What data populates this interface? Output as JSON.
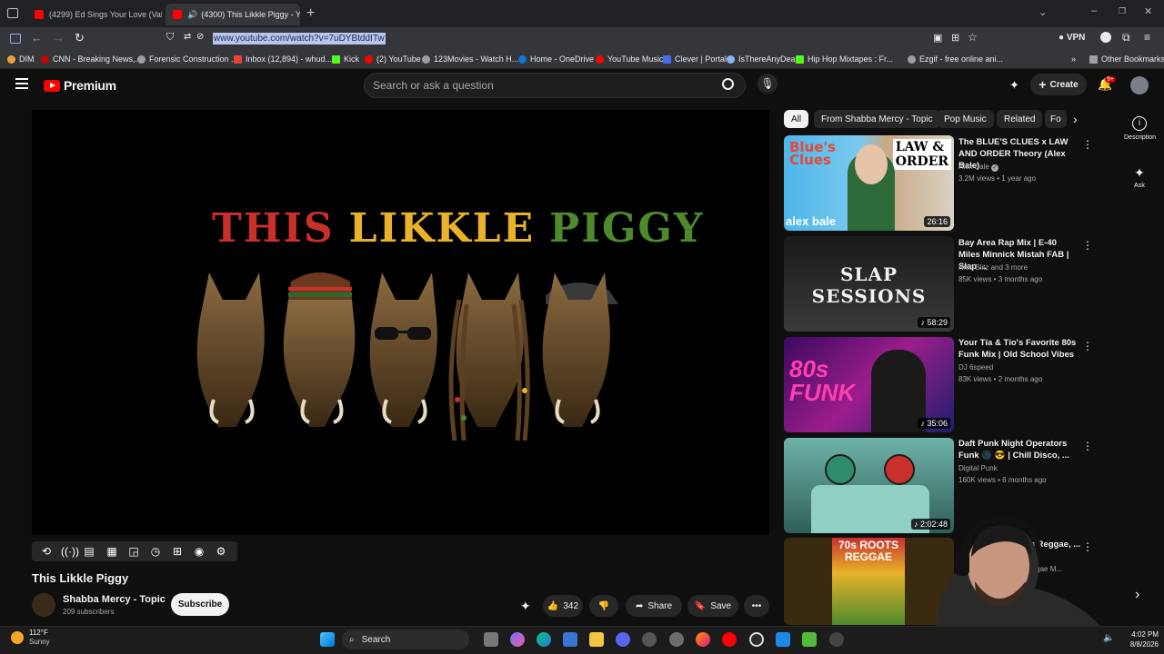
{
  "browser": {
    "tabs": [
      {
        "label": "(4299) Ed Sings Your Love (Vala…"
      },
      {
        "label": "(4300) This Likkle Piggy - Y…"
      }
    ],
    "url": "www.youtube.com/watch?v=7uDYBtddITw",
    "vpn_label": "VPN",
    "bookmarks": [
      "DIM",
      "CNN - Breaking News,...",
      "Forensic Construction ...",
      "Inbox (12,894) - whud...",
      "Kick",
      "(2) YouTube",
      "123Movies - Watch H...",
      "Home - OneDrive",
      "YouTube Music",
      "Clever | Portal",
      "IsThereAnyDeal",
      "Hip Hop Mixtapes : Fr...",
      "Ezgif - free online ani..."
    ],
    "other_bookmarks": "Other Bookmarks"
  },
  "yt": {
    "logo_text": "Premium",
    "search_placeholder": "Search or ask a question",
    "create_label": "Create",
    "notif_badge": "9+",
    "video_art": {
      "words": [
        "THIS",
        "LIKKLE",
        "PIGGY"
      ],
      "word_colors": [
        "#c9302c",
        "#e8b22a",
        "#4e8a2c"
      ]
    },
    "video_title": "This Likkle Piggy",
    "channel_name": "Shabba Mercy - Topic",
    "subscribers": "209 subscribers",
    "subscribe_label": "Subscribe",
    "likes": "342",
    "share_label": "Share",
    "save_label": "Save",
    "chips": [
      "All",
      "From Shabba Mercy - Topic",
      "Pop Music",
      "Related",
      "Fo"
    ],
    "side_rail": {
      "description": "Description",
      "ask": "Ask"
    },
    "recommendations": [
      {
        "title": "The BLUE'S CLUES x LAW AND ORDER Theory (Alex Bale)",
        "channel": "Alex Bale",
        "meta": "3.2M views • 1 year ago",
        "duration": "26:16",
        "thumb_text": "alex bale"
      },
      {
        "title": "Bay Area Rap Mix | E-40 Miles Minnick Mistah FAB | Slap ...",
        "channel": "Nico Blitz and 3 more",
        "meta": "85K views • 3 months ago",
        "duration": "58:29",
        "thumb_text": "SLAP SESSIONS"
      },
      {
        "title": "Your Tía & Tío's Favorite 80s Funk Mix | Old School Vibes",
        "channel": "DJ 6speed",
        "meta": "83K views • 2 months ago",
        "duration": "35:06",
        "thumb_text": "80s FUNK"
      },
      {
        "title": "Daft Punk Night Operators Funk 🌑 😎 | Chill Disco, ...",
        "channel": "Digital Punk",
        "meta": "160K views • 6 months ago",
        "duration": "2:02:48",
        "thumb_text": ""
      },
      {
        "title": "...oots Reggae, ... Box",
        "channel": "...ggae M...",
        "meta": "",
        "duration": "",
        "thumb_text": "70s ROOTS REGGAE"
      }
    ]
  },
  "taskbar": {
    "weather_temp": "112°F",
    "weather_desc": "Sunny",
    "search_label": "Search",
    "time": "4:02 PM",
    "date": "8/8/2026"
  }
}
